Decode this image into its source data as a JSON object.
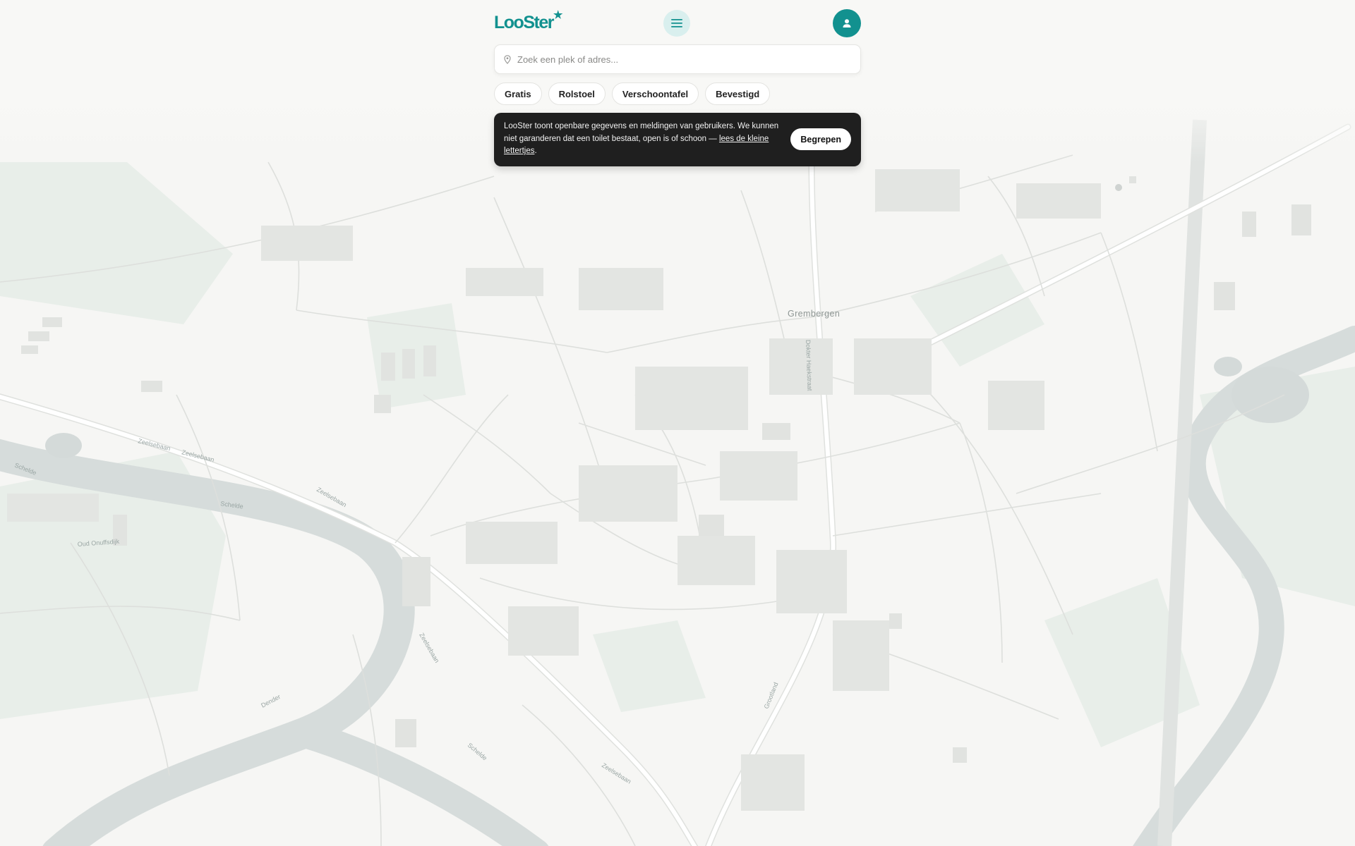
{
  "app": {
    "logo_text": "LooSter"
  },
  "search": {
    "placeholder": "Zoek een plek of adres..."
  },
  "filters": [
    {
      "label": "Gratis"
    },
    {
      "label": "Rolstoel"
    },
    {
      "label": "Verschoontafel"
    },
    {
      "label": "Bevestigd"
    }
  ],
  "notice": {
    "text": "LooSter toont openbare gegevens en meldingen van gebruikers. We kunnen niet garanderen dat een toilet bestaat, open is of schoon — ",
    "link_text": "lees de kleine lettertjes",
    "text_end": ".",
    "button_label": "Begrepen"
  },
  "map": {
    "place_label": "Grembergen",
    "street_labels": {
      "zeelsebaan_1": "Zeelsebaan",
      "zeelsebaan_2": "Zeelsebaan",
      "zeelsebaan_3": "Zeelsebaan",
      "zeelsebaan_4": "Zeelsebaan",
      "zeelsebaan_5": "Zeelsebaan",
      "schelde_1": "Schelde",
      "schelde_2": "Schelde",
      "schelde_3": "Schelde",
      "dender": "Dender",
      "hasktraat": "Dokter Haekstraat",
      "grootland": "Grootland",
      "oude_dijk": "Oud Onuffsdijk"
    },
    "colors": {
      "background": "#f6f6f4",
      "water": "#d8dedd",
      "green": "#e7ede9",
      "road": "#ffffff",
      "road_casing": "#dcdedb",
      "building": "#e2e4e1"
    }
  }
}
